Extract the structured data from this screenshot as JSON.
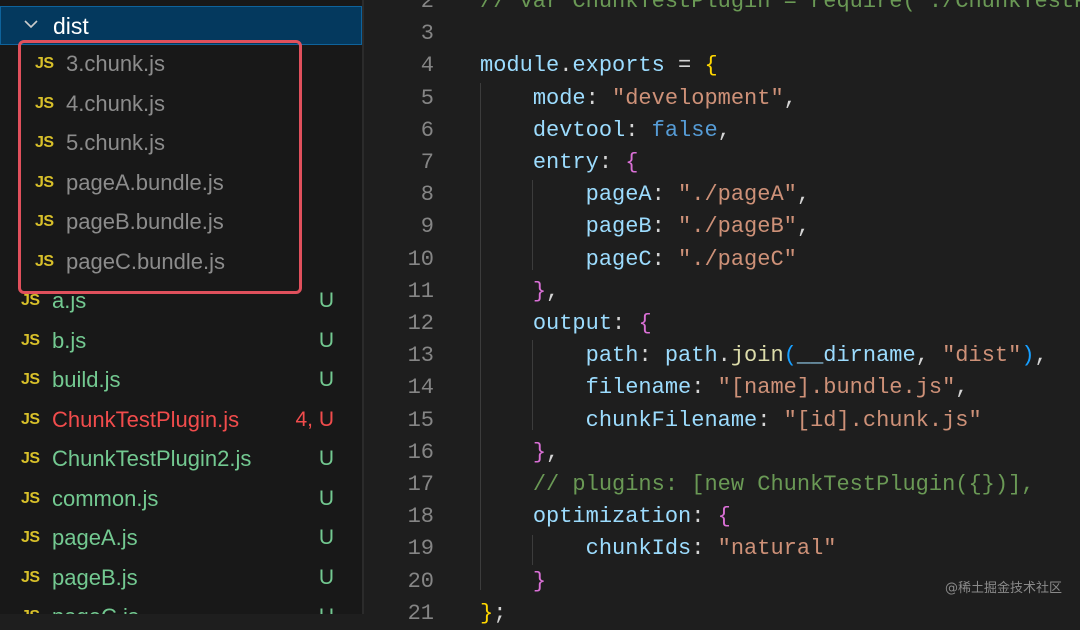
{
  "sidebar": {
    "folder": {
      "label": "dist",
      "expanded": true
    },
    "dist_files": [
      {
        "icon": "JS",
        "name": "3.chunk.js"
      },
      {
        "icon": "JS",
        "name": "4.chunk.js"
      },
      {
        "icon": "JS",
        "name": "5.chunk.js"
      },
      {
        "icon": "JS",
        "name": "pageA.bundle.js"
      },
      {
        "icon": "JS",
        "name": "pageB.bundle.js"
      },
      {
        "icon": "JS",
        "name": "pageC.bundle.js"
      }
    ],
    "files": [
      {
        "icon": "JS",
        "name": "a.js",
        "status": "U",
        "color": "#73c991"
      },
      {
        "icon": "JS",
        "name": "b.js",
        "status": "U",
        "color": "#73c991"
      },
      {
        "icon": "JS",
        "name": "build.js",
        "status": "U",
        "color": "#73c991"
      },
      {
        "icon": "JS",
        "name": "ChunkTestPlugin.js",
        "status": "4, U",
        "color": "#f14c4c"
      },
      {
        "icon": "JS",
        "name": "ChunkTestPlugin2.js",
        "status": "U",
        "color": "#73c991"
      },
      {
        "icon": "JS",
        "name": "common.js",
        "status": "U",
        "color": "#73c991"
      },
      {
        "icon": "JS",
        "name": "pageA.js",
        "status": "U",
        "color": "#73c991"
      },
      {
        "icon": "JS",
        "name": "pageB.js",
        "status": "U",
        "color": "#73c991"
      },
      {
        "icon": "JS",
        "name": "pageC.js",
        "status": "U",
        "color": "#73c991"
      }
    ]
  },
  "editor": {
    "lines": [
      {
        "n": "2",
        "tokens": [
          [
            "t-comment",
            "// var ChunkTestPlugin = require('./ChunkTestP"
          ]
        ]
      },
      {
        "n": "3",
        "tokens": []
      },
      {
        "n": "4",
        "tokens": [
          [
            "t-var",
            "module"
          ],
          [
            "t-plain",
            "."
          ],
          [
            "t-var",
            "exports"
          ],
          [
            "t-plain",
            " = "
          ],
          [
            "t-brace-y",
            "{"
          ]
        ]
      },
      {
        "n": "5",
        "tokens": [
          [
            "t-plain",
            "    "
          ],
          [
            "t-var",
            "mode"
          ],
          [
            "t-plain",
            ": "
          ],
          [
            "t-str",
            "\"development\""
          ],
          [
            "t-plain",
            ","
          ]
        ]
      },
      {
        "n": "6",
        "tokens": [
          [
            "t-plain",
            "    "
          ],
          [
            "t-var",
            "devtool"
          ],
          [
            "t-plain",
            ": "
          ],
          [
            "t-bool",
            "false"
          ],
          [
            "t-plain",
            ","
          ]
        ]
      },
      {
        "n": "7",
        "tokens": [
          [
            "t-plain",
            "    "
          ],
          [
            "t-var",
            "entry"
          ],
          [
            "t-plain",
            ": "
          ],
          [
            "t-brace-p",
            "{"
          ]
        ]
      },
      {
        "n": "8",
        "tokens": [
          [
            "t-plain",
            "        "
          ],
          [
            "t-var",
            "pageA"
          ],
          [
            "t-plain",
            ": "
          ],
          [
            "t-str",
            "\"./pageA\""
          ],
          [
            "t-plain",
            ","
          ]
        ]
      },
      {
        "n": "9",
        "tokens": [
          [
            "t-plain",
            "        "
          ],
          [
            "t-var",
            "pageB"
          ],
          [
            "t-plain",
            ": "
          ],
          [
            "t-str",
            "\"./pageB\""
          ],
          [
            "t-plain",
            ","
          ]
        ]
      },
      {
        "n": "10",
        "tokens": [
          [
            "t-plain",
            "        "
          ],
          [
            "t-var",
            "pageC"
          ],
          [
            "t-plain",
            ": "
          ],
          [
            "t-str",
            "\"./pageC\""
          ]
        ]
      },
      {
        "n": "11",
        "tokens": [
          [
            "t-plain",
            "    "
          ],
          [
            "t-brace-p",
            "}"
          ],
          [
            "t-plain",
            ","
          ]
        ]
      },
      {
        "n": "12",
        "tokens": [
          [
            "t-plain",
            "    "
          ],
          [
            "t-var",
            "output"
          ],
          [
            "t-plain",
            ": "
          ],
          [
            "t-brace-p",
            "{"
          ]
        ]
      },
      {
        "n": "13",
        "tokens": [
          [
            "t-plain",
            "        "
          ],
          [
            "t-var",
            "path"
          ],
          [
            "t-plain",
            ": "
          ],
          [
            "t-var",
            "path"
          ],
          [
            "t-plain",
            "."
          ],
          [
            "t-func",
            "join"
          ],
          [
            "t-brace-b",
            "("
          ],
          [
            "t-var",
            "__dirname"
          ],
          [
            "t-plain",
            ", "
          ],
          [
            "t-str",
            "\"dist\""
          ],
          [
            "t-brace-b",
            ")"
          ],
          [
            "t-plain",
            ","
          ]
        ]
      },
      {
        "n": "14",
        "tokens": [
          [
            "t-plain",
            "        "
          ],
          [
            "t-var",
            "filename"
          ],
          [
            "t-plain",
            ": "
          ],
          [
            "t-str",
            "\"[name].bundle.js\""
          ],
          [
            "t-plain",
            ","
          ]
        ]
      },
      {
        "n": "15",
        "tokens": [
          [
            "t-plain",
            "        "
          ],
          [
            "t-var",
            "chunkFilename"
          ],
          [
            "t-plain",
            ": "
          ],
          [
            "t-str",
            "\"[id].chunk.js\""
          ]
        ]
      },
      {
        "n": "16",
        "tokens": [
          [
            "t-plain",
            "    "
          ],
          [
            "t-brace-p",
            "}"
          ],
          [
            "t-plain",
            ","
          ]
        ]
      },
      {
        "n": "17",
        "tokens": [
          [
            "t-plain",
            "    "
          ],
          [
            "t-comment",
            "// plugins: [new ChunkTestPlugin({})],"
          ]
        ]
      },
      {
        "n": "18",
        "tokens": [
          [
            "t-plain",
            "    "
          ],
          [
            "t-var",
            "optimization"
          ],
          [
            "t-plain",
            ": "
          ],
          [
            "t-brace-p",
            "{"
          ]
        ]
      },
      {
        "n": "19",
        "tokens": [
          [
            "t-plain",
            "        "
          ],
          [
            "t-var",
            "chunkIds"
          ],
          [
            "t-plain",
            ": "
          ],
          [
            "t-str",
            "\"natural\""
          ]
        ]
      },
      {
        "n": "20",
        "tokens": [
          [
            "t-plain",
            "    "
          ],
          [
            "t-brace-p",
            "}"
          ]
        ]
      },
      {
        "n": "21",
        "tokens": [
          [
            "t-brace-y",
            "}"
          ],
          [
            "t-plain",
            ";"
          ]
        ]
      }
    ]
  },
  "watermark": "@稀土掘金技术社区"
}
